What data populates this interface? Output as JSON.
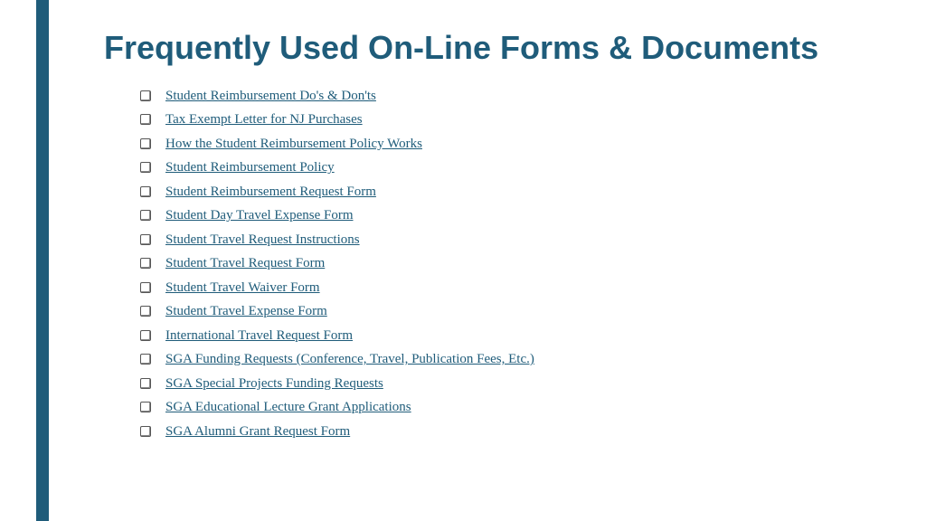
{
  "title": "Frequently Used On-Line Forms & Documents",
  "links": [
    "Student Reimbursement Do's & Don'ts",
    "Tax Exempt Letter for NJ Purchases",
    "How the Student Reimbursement Policy Works",
    "Student Reimbursement Policy",
    "Student Reimbursement Request Form",
    "Student Day Travel Expense Form",
    "Student Travel Request Instructions",
    "Student Travel Request Form",
    "Student Travel Waiver Form",
    "Student Travel Expense Form",
    "International Travel Request Form",
    "SGA Funding Requests (Conference, Travel, Publication Fees, Etc.)",
    "SGA Special Projects Funding Requests",
    "SGA Educational Lecture Grant Applications",
    "SGA Alumni Grant Request Form"
  ]
}
